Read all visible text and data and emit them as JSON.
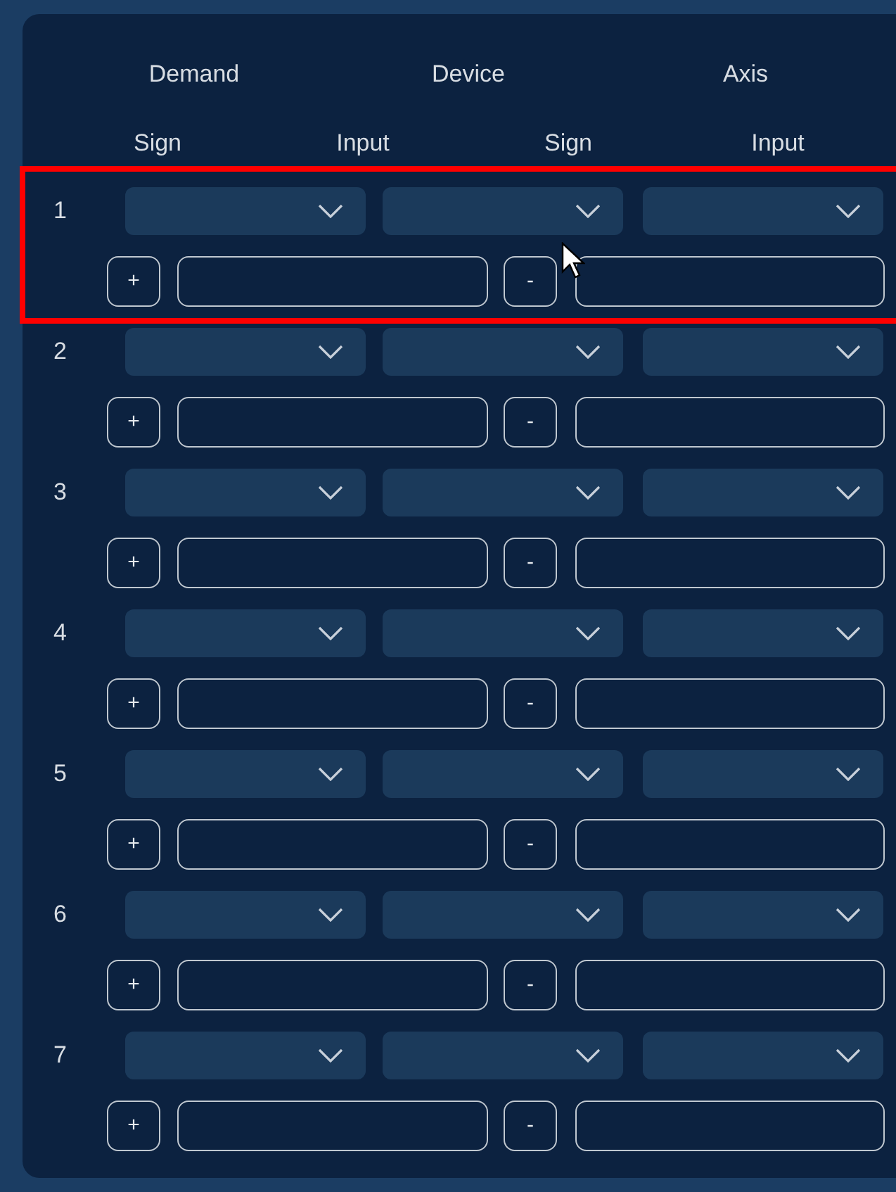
{
  "headers": [
    "Demand",
    "Device",
    "Axis"
  ],
  "subheaders": [
    "Sign",
    "Input",
    "Sign",
    "Input"
  ],
  "rows": [
    {
      "number": "1",
      "highlighted": true,
      "plus": "+",
      "minus": "-"
    },
    {
      "number": "2",
      "highlighted": false,
      "plus": "+",
      "minus": "-"
    },
    {
      "number": "3",
      "highlighted": false,
      "plus": "+",
      "minus": "-"
    },
    {
      "number": "4",
      "highlighted": false,
      "plus": "+",
      "minus": "-"
    },
    {
      "number": "5",
      "highlighted": false,
      "plus": "+",
      "minus": "-"
    },
    {
      "number": "6",
      "highlighted": false,
      "plus": "+",
      "minus": "-"
    },
    {
      "number": "7",
      "highlighted": false,
      "plus": "+",
      "minus": "-"
    }
  ]
}
